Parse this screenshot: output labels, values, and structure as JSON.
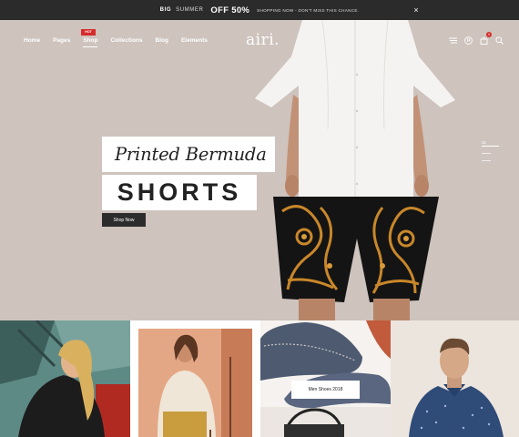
{
  "promo": {
    "big": "BIG",
    "summer": "SUMMER",
    "off": "OFF 50%",
    "message": "SHOPPING NOW - DON'T MISS THIS CHANCE.",
    "close": "×"
  },
  "nav": {
    "items": [
      {
        "label": "Home"
      },
      {
        "label": "Pages"
      },
      {
        "label": "Shop",
        "badge": "HOT"
      },
      {
        "label": "Collections"
      },
      {
        "label": "Blog"
      },
      {
        "label": "Elements"
      }
    ]
  },
  "logo": "airi.",
  "header_icons": {
    "menu": "hamburger-icon",
    "account": "user-icon",
    "cart": "bag-icon",
    "cart_count": "0",
    "search": "search-icon"
  },
  "hero": {
    "headline_line1": "Printed Bermuda",
    "headline_line2": "SHORTS",
    "cta": "Shop Now",
    "slide_number": "01"
  },
  "tiles": {
    "shoes_label": "Men Shoes 2018"
  },
  "colors": {
    "hero_bg": "#cec3bd",
    "promo_bg": "#2b2b2b",
    "badge": "#d62b2b"
  }
}
